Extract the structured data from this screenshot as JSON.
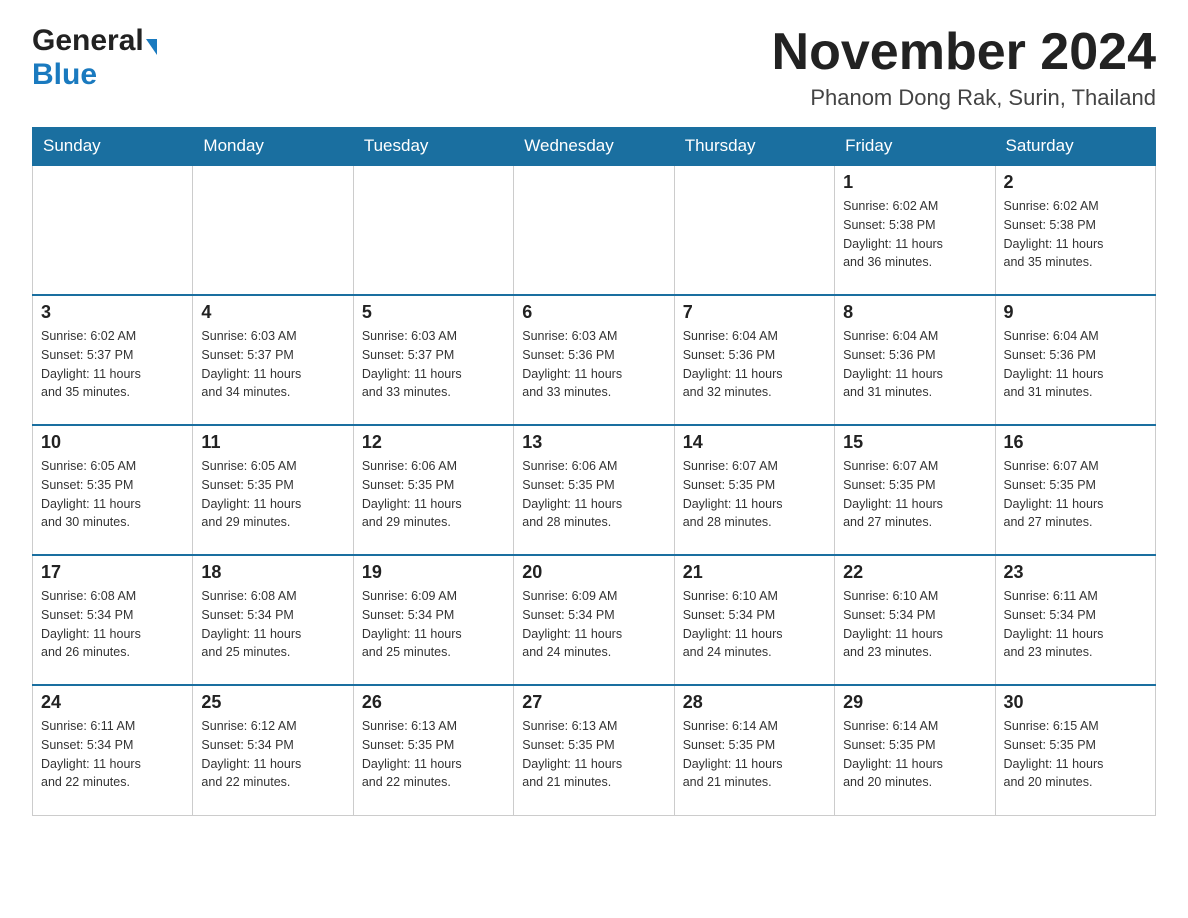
{
  "header": {
    "month_title": "November 2024",
    "location": "Phanom Dong Rak, Surin, Thailand",
    "logo_general": "General",
    "logo_blue": "Blue"
  },
  "days_of_week": [
    "Sunday",
    "Monday",
    "Tuesday",
    "Wednesday",
    "Thursday",
    "Friday",
    "Saturday"
  ],
  "weeks": [
    {
      "days": [
        {
          "number": "",
          "info": ""
        },
        {
          "number": "",
          "info": ""
        },
        {
          "number": "",
          "info": ""
        },
        {
          "number": "",
          "info": ""
        },
        {
          "number": "",
          "info": ""
        },
        {
          "number": "1",
          "info": "Sunrise: 6:02 AM\nSunset: 5:38 PM\nDaylight: 11 hours\nand 36 minutes."
        },
        {
          "number": "2",
          "info": "Sunrise: 6:02 AM\nSunset: 5:38 PM\nDaylight: 11 hours\nand 35 minutes."
        }
      ]
    },
    {
      "days": [
        {
          "number": "3",
          "info": "Sunrise: 6:02 AM\nSunset: 5:37 PM\nDaylight: 11 hours\nand 35 minutes."
        },
        {
          "number": "4",
          "info": "Sunrise: 6:03 AM\nSunset: 5:37 PM\nDaylight: 11 hours\nand 34 minutes."
        },
        {
          "number": "5",
          "info": "Sunrise: 6:03 AM\nSunset: 5:37 PM\nDaylight: 11 hours\nand 33 minutes."
        },
        {
          "number": "6",
          "info": "Sunrise: 6:03 AM\nSunset: 5:36 PM\nDaylight: 11 hours\nand 33 minutes."
        },
        {
          "number": "7",
          "info": "Sunrise: 6:04 AM\nSunset: 5:36 PM\nDaylight: 11 hours\nand 32 minutes."
        },
        {
          "number": "8",
          "info": "Sunrise: 6:04 AM\nSunset: 5:36 PM\nDaylight: 11 hours\nand 31 minutes."
        },
        {
          "number": "9",
          "info": "Sunrise: 6:04 AM\nSunset: 5:36 PM\nDaylight: 11 hours\nand 31 minutes."
        }
      ]
    },
    {
      "days": [
        {
          "number": "10",
          "info": "Sunrise: 6:05 AM\nSunset: 5:35 PM\nDaylight: 11 hours\nand 30 minutes."
        },
        {
          "number": "11",
          "info": "Sunrise: 6:05 AM\nSunset: 5:35 PM\nDaylight: 11 hours\nand 29 minutes."
        },
        {
          "number": "12",
          "info": "Sunrise: 6:06 AM\nSunset: 5:35 PM\nDaylight: 11 hours\nand 29 minutes."
        },
        {
          "number": "13",
          "info": "Sunrise: 6:06 AM\nSunset: 5:35 PM\nDaylight: 11 hours\nand 28 minutes."
        },
        {
          "number": "14",
          "info": "Sunrise: 6:07 AM\nSunset: 5:35 PM\nDaylight: 11 hours\nand 28 minutes."
        },
        {
          "number": "15",
          "info": "Sunrise: 6:07 AM\nSunset: 5:35 PM\nDaylight: 11 hours\nand 27 minutes."
        },
        {
          "number": "16",
          "info": "Sunrise: 6:07 AM\nSunset: 5:35 PM\nDaylight: 11 hours\nand 27 minutes."
        }
      ]
    },
    {
      "days": [
        {
          "number": "17",
          "info": "Sunrise: 6:08 AM\nSunset: 5:34 PM\nDaylight: 11 hours\nand 26 minutes."
        },
        {
          "number": "18",
          "info": "Sunrise: 6:08 AM\nSunset: 5:34 PM\nDaylight: 11 hours\nand 25 minutes."
        },
        {
          "number": "19",
          "info": "Sunrise: 6:09 AM\nSunset: 5:34 PM\nDaylight: 11 hours\nand 25 minutes."
        },
        {
          "number": "20",
          "info": "Sunrise: 6:09 AM\nSunset: 5:34 PM\nDaylight: 11 hours\nand 24 minutes."
        },
        {
          "number": "21",
          "info": "Sunrise: 6:10 AM\nSunset: 5:34 PM\nDaylight: 11 hours\nand 24 minutes."
        },
        {
          "number": "22",
          "info": "Sunrise: 6:10 AM\nSunset: 5:34 PM\nDaylight: 11 hours\nand 23 minutes."
        },
        {
          "number": "23",
          "info": "Sunrise: 6:11 AM\nSunset: 5:34 PM\nDaylight: 11 hours\nand 23 minutes."
        }
      ]
    },
    {
      "days": [
        {
          "number": "24",
          "info": "Sunrise: 6:11 AM\nSunset: 5:34 PM\nDaylight: 11 hours\nand 22 minutes."
        },
        {
          "number": "25",
          "info": "Sunrise: 6:12 AM\nSunset: 5:34 PM\nDaylight: 11 hours\nand 22 minutes."
        },
        {
          "number": "26",
          "info": "Sunrise: 6:13 AM\nSunset: 5:35 PM\nDaylight: 11 hours\nand 22 minutes."
        },
        {
          "number": "27",
          "info": "Sunrise: 6:13 AM\nSunset: 5:35 PM\nDaylight: 11 hours\nand 21 minutes."
        },
        {
          "number": "28",
          "info": "Sunrise: 6:14 AM\nSunset: 5:35 PM\nDaylight: 11 hours\nand 21 minutes."
        },
        {
          "number": "29",
          "info": "Sunrise: 6:14 AM\nSunset: 5:35 PM\nDaylight: 11 hours\nand 20 minutes."
        },
        {
          "number": "30",
          "info": "Sunrise: 6:15 AM\nSunset: 5:35 PM\nDaylight: 11 hours\nand 20 minutes."
        }
      ]
    }
  ]
}
